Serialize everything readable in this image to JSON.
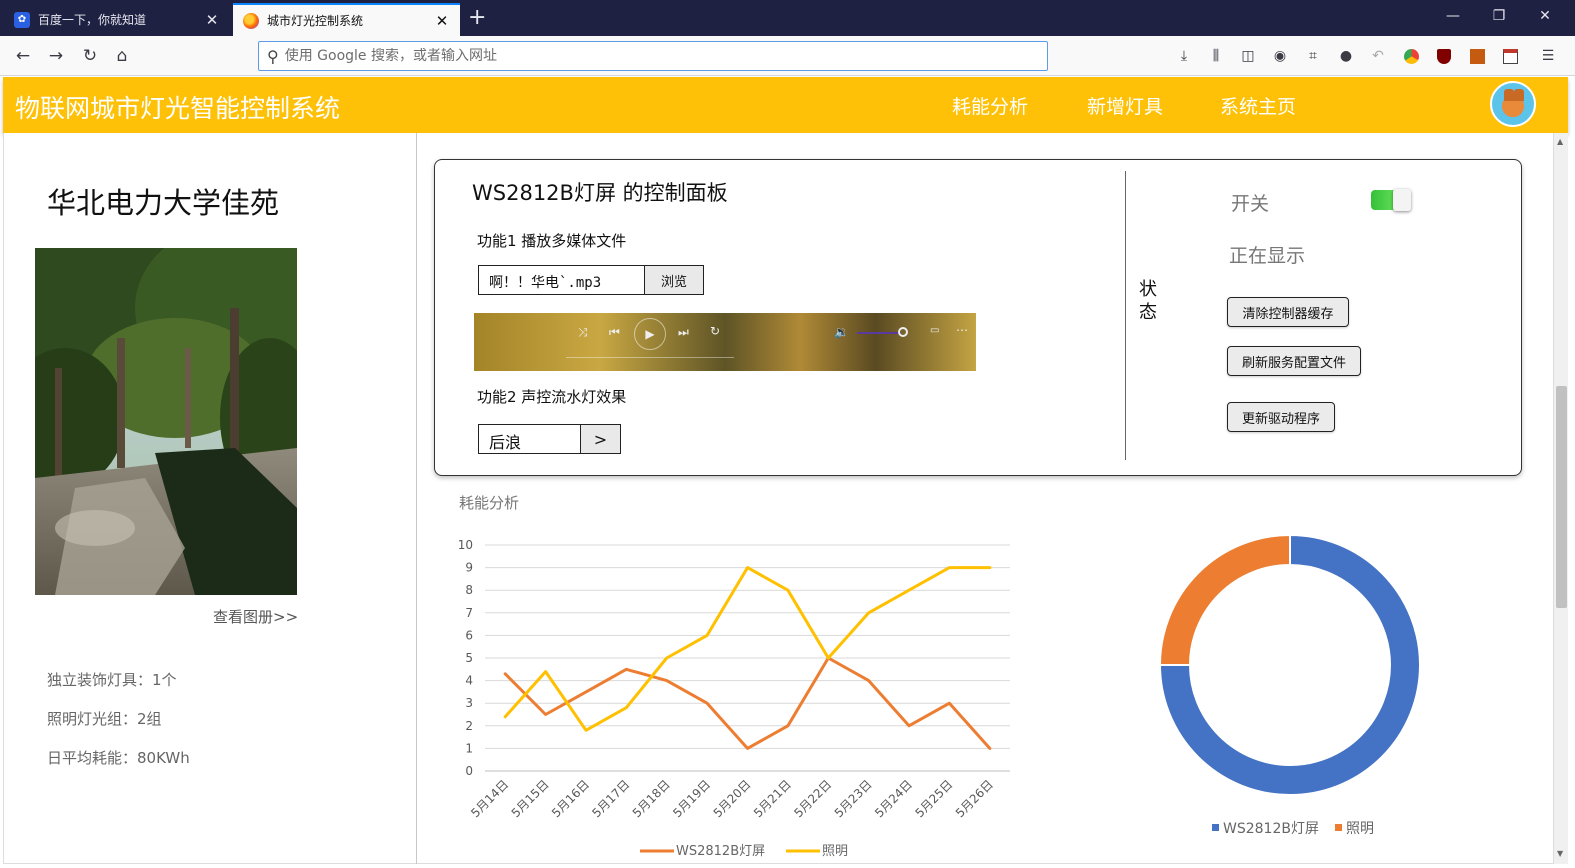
{
  "browser": {
    "tabs": [
      {
        "title": "百度一下，你就知道",
        "favicon": "baidu-icon",
        "active": false
      },
      {
        "title": "城市灯光控制系统",
        "favicon": "firefox-icon",
        "active": true
      }
    ],
    "url_placeholder": "使用 Google 搜索，或者输入网址"
  },
  "header": {
    "title": "物联网城市灯光智能控制系统",
    "nav": [
      "耗能分析",
      "新增灯具",
      "系统主页"
    ],
    "bg_color": "#fec107"
  },
  "sidebar": {
    "place_name": "华北电力大学佳苑",
    "gallery_link": "查看图册>>",
    "stats": [
      "独立装饰灯具：1个",
      "照明灯光组：2组",
      "日平均耗能：80KWh"
    ]
  },
  "panel": {
    "title": "WS2812B灯屏 的控制面板",
    "func1_label": "功能1  播放多媒体文件",
    "file_value": "啊！！华电`.mp3",
    "browse_label": "浏览",
    "func2_label": "功能2  声控流水灯效果",
    "mode_value": "后浪",
    "go_label": ">",
    "status_label": "状态",
    "switch_label": "开关",
    "switch_on": true,
    "status_value": "正在显示",
    "buttons": [
      "清除控制器缓存",
      "刷新服务配置文件",
      "更新驱动程序"
    ]
  },
  "analysis": {
    "title": "耗能分析"
  },
  "chart_data": [
    {
      "type": "line",
      "title": "",
      "x": [
        "5月14日",
        "5月15日",
        "5月16日",
        "5月17日",
        "5月18日",
        "5月19日",
        "5月20日",
        "5月21日",
        "5月22日",
        "5月23日",
        "5月24日",
        "5月25日",
        "5月26日"
      ],
      "ylim": [
        0,
        10
      ],
      "yticks": [
        0,
        1,
        2,
        3,
        4,
        5,
        6,
        7,
        8,
        9,
        10
      ],
      "grid": true,
      "legend": "bottom",
      "series": [
        {
          "name": "WS2812B灯屏",
          "color": "#ed7d31",
          "values": [
            4.3,
            2.5,
            3.5,
            4.5,
            4,
            3,
            1,
            2,
            5,
            4,
            2,
            3,
            1
          ]
        },
        {
          "name": "照明",
          "color": "#ffc000",
          "values": [
            2.4,
            4.4,
            1.8,
            2.8,
            5,
            6,
            9,
            8,
            5,
            7,
            8,
            9,
            9
          ]
        }
      ]
    },
    {
      "type": "pie",
      "title": "",
      "donut": true,
      "legend": "bottom",
      "slices": [
        {
          "name": "WS2812B灯屏",
          "color": "#4472c4",
          "value": 75
        },
        {
          "name": "照明",
          "color": "#ed7d31",
          "value": 25
        }
      ]
    }
  ]
}
